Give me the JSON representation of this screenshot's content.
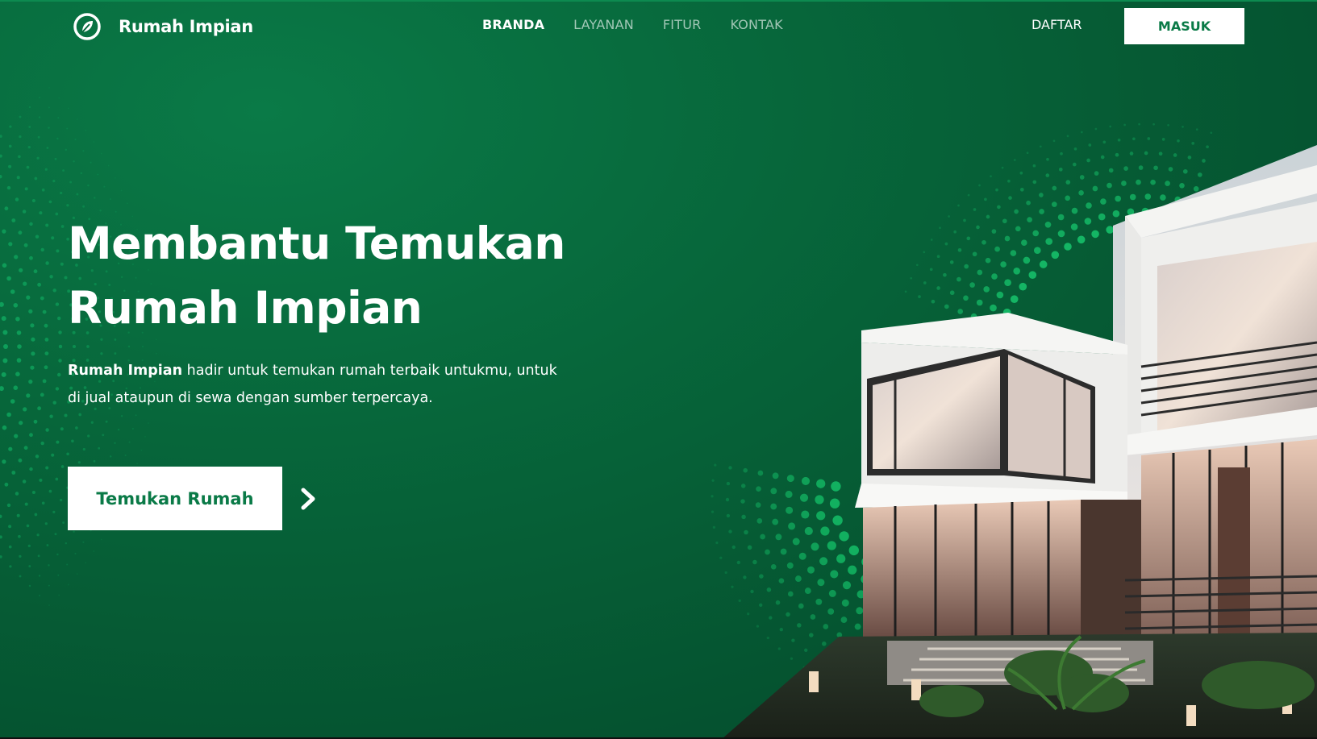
{
  "brand": {
    "name": "Rumah Impian",
    "icon": "leaf-circle-icon"
  },
  "nav": {
    "items": [
      {
        "label": "BRANDA",
        "active": true
      },
      {
        "label": "LAYANAN",
        "active": false
      },
      {
        "label": "FITUR",
        "active": false
      },
      {
        "label": "KONTAK",
        "active": false
      }
    ]
  },
  "auth": {
    "register_label": "DAFTAR",
    "login_label": "MASUK"
  },
  "hero": {
    "title_line1": "Membantu Temukan",
    "title_line2": "Rumah Impian",
    "desc_bold": "Rumah Impian",
    "desc_rest_line1": " hadir untuk temukan rumah terbaik untukmu, untuk",
    "desc_line2": "di jual ataupun di sewa dengan sumber terpercaya.",
    "cta_label": "Temukan Rumah",
    "cta_icon": "chevron-right-icon"
  },
  "colors": {
    "primary": "#0a7a47",
    "background_dark": "#044529",
    "white": "#ffffff"
  }
}
